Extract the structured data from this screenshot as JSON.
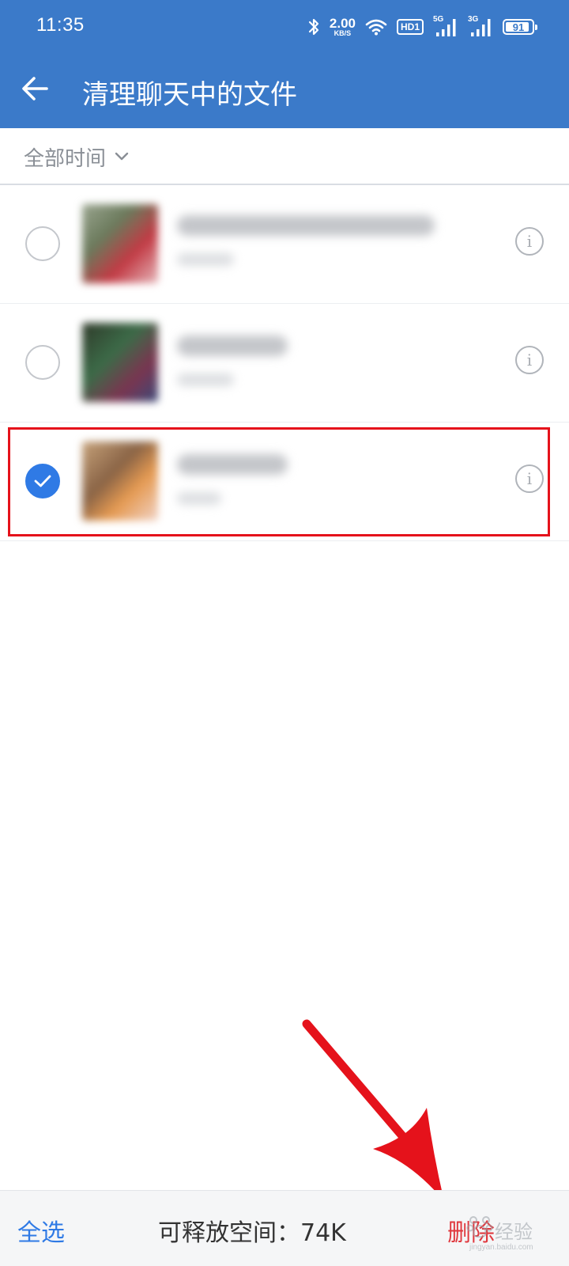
{
  "status_bar": {
    "time": "11:35",
    "net_speed_value": "2.00",
    "net_speed_unit": "KB/S",
    "hd_badge": "HD1",
    "signal_1_label": "5G",
    "signal_2_label": "3G",
    "battery_level": "91",
    "battery_fraction": 0.91,
    "icons": [
      "bluetooth-icon",
      "wifi-icon",
      "signal-icon",
      "battery-icon"
    ]
  },
  "app_bar": {
    "title": "清理聊天中的文件",
    "back_icon": "arrow-left-icon"
  },
  "filter": {
    "time_label": "全部时间",
    "dropdown_icon": "chevron-down-icon"
  },
  "files": [
    {
      "checked": false
    },
    {
      "checked": false
    },
    {
      "checked": true
    }
  ],
  "bottom_bar": {
    "select_all": "全选",
    "free_space": "可释放空间：74K",
    "delete": "删除",
    "watermark_text": "经验",
    "watermark_sub": "jingyan.baidu.com"
  },
  "colors": {
    "header_bg": "#3b7ac9",
    "accent_blue": "#2f7ae5",
    "delete_red": "#e0383e",
    "annotation_red": "#e5121b"
  }
}
